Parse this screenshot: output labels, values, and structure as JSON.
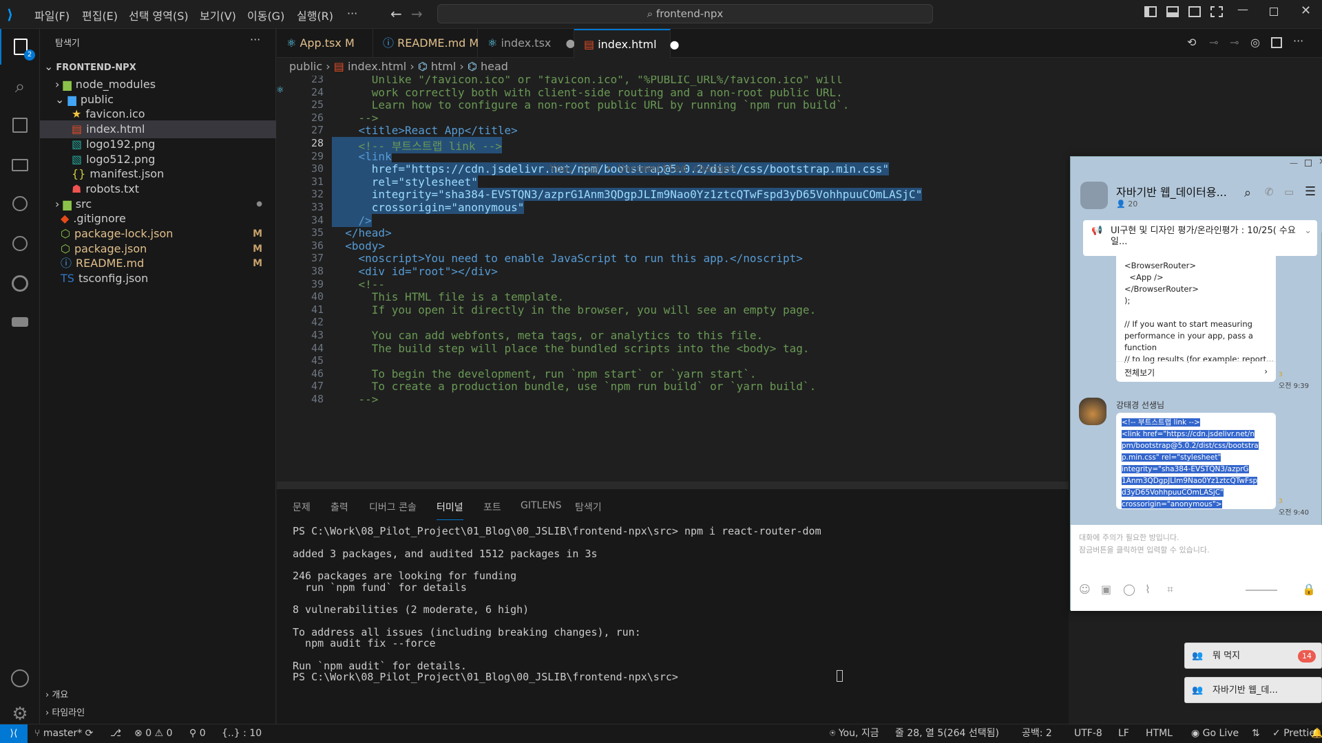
{
  "menu": [
    "파일(F)",
    "편집(E)",
    "선택 영역(S)",
    "보기(V)",
    "이동(G)",
    "실행(R)",
    "···"
  ],
  "search": {
    "text": "frontend-npx"
  },
  "explorer": {
    "title": "탐색기",
    "root": "FRONTEND-NPX",
    "items": [
      {
        "label": "node_modules",
        "type": "folder",
        "color": "#8bc34a"
      },
      {
        "label": "public",
        "type": "folder-open",
        "color": "#42a5f5"
      },
      {
        "label": "favicon.ico",
        "type": "file",
        "icon": "star",
        "color": "#f4c542"
      },
      {
        "label": "index.html",
        "type": "file",
        "icon": "html",
        "color": "#e44d26"
      },
      {
        "label": "logo192.png",
        "type": "file",
        "icon": "image",
        "color": "#26a69a"
      },
      {
        "label": "logo512.png",
        "type": "file",
        "icon": "image",
        "color": "#26a69a"
      },
      {
        "label": "manifest.json",
        "type": "file",
        "icon": "json",
        "color": "#cbcb41"
      },
      {
        "label": "robots.txt",
        "type": "file",
        "icon": "robot",
        "color": "#ef5350"
      },
      {
        "label": "src",
        "type": "folder",
        "color": "#8bc34a"
      },
      {
        "label": ".gitignore",
        "type": "file",
        "icon": "git",
        "color": "#e64a19"
      },
      {
        "label": "package-lock.json",
        "type": "file",
        "icon": "node",
        "color": "#8bc34a",
        "badge": "M"
      },
      {
        "label": "package.json",
        "type": "file",
        "icon": "node",
        "color": "#8bc34a",
        "badge": "M"
      },
      {
        "label": "README.md",
        "type": "file",
        "icon": "info",
        "color": "#42a5f5",
        "badge": "M"
      },
      {
        "label": "tsconfig.json",
        "type": "file",
        "icon": "ts",
        "color": "#3178c6"
      }
    ],
    "outline": "개요",
    "timeline": "타임라인"
  },
  "tabs": [
    {
      "label": "App.tsx",
      "badge": "M",
      "icon": "react"
    },
    {
      "label": "README.md",
      "badge": "M",
      "icon": "info"
    },
    {
      "label": "index.tsx",
      "badge": "●",
      "icon": "react"
    },
    {
      "label": "index.html",
      "badge": "●",
      "icon": "html",
      "active": true
    }
  ],
  "breadcrumbs": [
    "public",
    "index.html",
    "html",
    "head"
  ],
  "editor": {
    "blame": "You, 지금 • Uncommitted changes",
    "lines": [
      {
        "n": "23",
        "text": "      Unlike \"/favicon.ico\" or \"favicon.ico\", \"%PUBLIC_URL%/favicon.ico\" will",
        "cls": "t-cmt"
      },
      {
        "n": "24",
        "text": "      work correctly both with client-side routing and a non-root public URL.",
        "cls": "t-cmt"
      },
      {
        "n": "25",
        "text": "      Learn how to configure a non-root public URL by running `npm run build`.",
        "cls": "t-cmt"
      },
      {
        "n": "26",
        "text": "    -->",
        "cls": "t-cmt"
      },
      {
        "n": "27",
        "text": "    <title>React App</title>",
        "cls": "t-tag"
      },
      {
        "n": "28",
        "text": "    <!-- 부트스트랩 link -->",
        "cls": "t-cmt",
        "sel": true
      },
      {
        "n": "29",
        "text": "    <link",
        "cls": "t-tag",
        "sel": true
      },
      {
        "n": "30",
        "text": "      href=\"https://cdn.jsdelivr.net/npm/bootstrap@5.0.2/dist/css/bootstrap.min.css\"",
        "cls": "t-attr",
        "sel": true
      },
      {
        "n": "31",
        "text": "      rel=\"stylesheet\"",
        "cls": "t-attr",
        "sel": true
      },
      {
        "n": "32",
        "text": "      integrity=\"sha384-EVSTQN3/azprG1Anm3QDgpJLIm9Nao0Yz1ztcQTwFspd3yD65VohhpuuCOmLASjC\"",
        "cls": "t-attr",
        "sel": true
      },
      {
        "n": "33",
        "text": "      crossorigin=\"anonymous\"",
        "cls": "t-attr",
        "sel": true
      },
      {
        "n": "34",
        "text": "    />",
        "cls": "t-tag",
        "sel": true
      },
      {
        "n": "35",
        "text": "  </head>",
        "cls": "t-tag"
      },
      {
        "n": "36",
        "text": "  <body>",
        "cls": "t-tag"
      },
      {
        "n": "37",
        "text": "    <noscript>You need to enable JavaScript to run this app.</noscript>",
        "cls": "t-tag"
      },
      {
        "n": "38",
        "text": "    <div id=\"root\"></div>",
        "cls": "t-tag"
      },
      {
        "n": "39",
        "text": "    <!--",
        "cls": "t-cmt"
      },
      {
        "n": "40",
        "text": "      This HTML file is a template.",
        "cls": "t-cmt"
      },
      {
        "n": "41",
        "text": "      If you open it directly in the browser, you will see an empty page.",
        "cls": "t-cmt"
      },
      {
        "n": "42",
        "text": "",
        "cls": "t-cmt"
      },
      {
        "n": "43",
        "text": "      You can add webfonts, meta tags, or analytics to this file.",
        "cls": "t-cmt"
      },
      {
        "n": "44",
        "text": "      The build step will place the bundled scripts into the <body> tag.",
        "cls": "t-cmt"
      },
      {
        "n": "45",
        "text": "",
        "cls": "t-cmt"
      },
      {
        "n": "46",
        "text": "      To begin the development, run `npm start` or `yarn start`.",
        "cls": "t-cmt"
      },
      {
        "n": "47",
        "text": "      To create a production bundle, use `npm run build` or `yarn build`.",
        "cls": "t-cmt"
      },
      {
        "n": "48",
        "text": "    -->",
        "cls": "t-cmt"
      }
    ]
  },
  "panel": {
    "tabs": [
      "문제",
      "출력",
      "디버그 콘솔",
      "터미널",
      "포트",
      "GITLENS",
      "탐색기"
    ],
    "active": "터미널",
    "terminal": [
      "PS C:\\Work\\08_Pilot_Project\\01_Blog\\00_JSLIB\\frontend-npx\\src> npm i react-router-dom",
      "",
      "added 3 packages, and audited 1512 packages in 3s",
      "",
      "246 packages are looking for funding",
      "  run `npm fund` for details",
      "",
      "8 vulnerabilities (2 moderate, 6 high)",
      "",
      "To address all issues (including breaking changes), run:",
      "  npm audit fix --force",
      "",
      "Run `npm audit` for details.",
      "PS C:\\Work\\08_Pilot_Project\\01_Blog\\00_JSLIB\\frontend-npx\\src> "
    ]
  },
  "status": {
    "branch": "master*",
    "errors": "0",
    "warnings": "0",
    "ports": "0",
    "braces": "{..} : 10",
    "blame": "You, 지금",
    "position": "줄 28, 열 5(264 선택됨)",
    "indent": "공백: 2",
    "encoding": "UTF-8",
    "eol": "LF",
    "lang": "HTML",
    "golive": "Go Live",
    "prettier": "Prettier"
  },
  "chat": {
    "title": "자바기반 웹_데이터용...",
    "members": "20",
    "notice": "UI구현 및 디자인 평가/온라인평가 : 10/25( 수요일...",
    "msg1": [
      "<BrowserRouter>",
      "  <App />",
      "</BrowserRouter>",
      ");",
      "",
      "// If you want to start measuring",
      "performance in your app, pass a",
      "function",
      "// to log results (for example: report..."
    ],
    "msg1_more": "전체보기",
    "msg1_time": "오전 9:39",
    "msg1_read": "3",
    "sender": "강태경 선생님",
    "msg2": [
      "<!-- 부트스트랩 link -->",
      "<link href=\"https://cdn.jsdelivr.net/n",
      "pm/bootstrap@5.0.2/dist/css/bootstra",
      "p.min.css\" rel=\"stylesheet\"",
      "  integrity=\"sha384-EVSTQN3/azprG",
      "1Anm3QDgpJLIm9Nao0Yz1ztcQTwFsp",
      "d3yD65VohhpuuCOmLASjC\"",
      "crossorigin=\"anonymous\">"
    ],
    "msg2_time": "오전 9:40",
    "msg2_read": "3",
    "placeholder1": "대화에 주의가 필요한 방입니다.",
    "placeholder2": "잠금버튼을 클릭하면 입력할 수 있습니다."
  },
  "chips": [
    {
      "label": "뭐 먹지",
      "count": "14"
    },
    {
      "label": "자바기반 웹_데..."
    }
  ],
  "colors": {
    "accent": "#0078d4",
    "bg": "#1f1f1f",
    "sidebar": "#181818",
    "selection": "#264f78",
    "kakao": "#b2c7da"
  }
}
